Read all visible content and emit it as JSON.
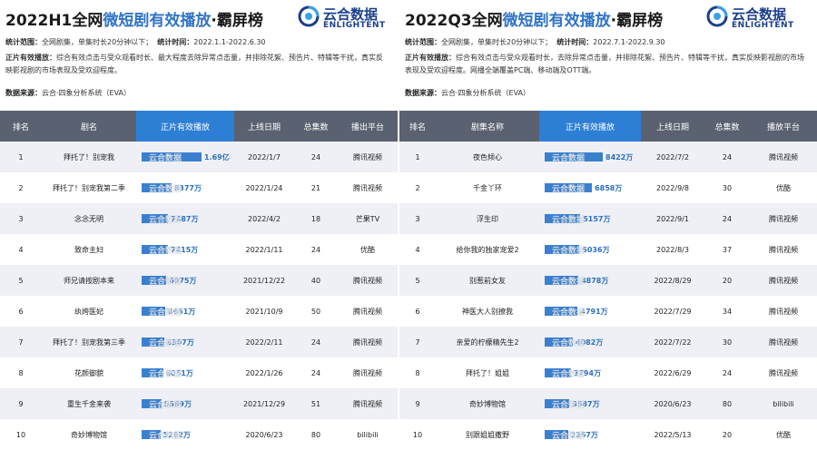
{
  "left": {
    "title_pre": "2022H1全网",
    "title_hl": "微短剧有效播放",
    "title_post": "·霸屏榜",
    "brand_name": "云合数据",
    "brand_sub": "ENLIGHTENT",
    "stat_range_label": "统计范围：",
    "stat_range": "全网剧集，单集时长20分钟以下；",
    "stat_time_label": "统计时间：",
    "stat_time": "2022.1.1-2022.6.30",
    "def_label": "正片有效播放：",
    "def_text": "综合有效点击与受众观看时长、最大程度去除异常点击量，并排除花絮、预告片、特辑等干扰，真实反映影视剧的市场表现及受欢迎程度。",
    "source_label": "数据来源：",
    "source": "云合·四象分析系统（EVA）",
    "headers": [
      "排名",
      "剧名",
      "正片有效播放",
      "上线日期",
      "总集数",
      "播出平台"
    ],
    "watermark": "云合数据",
    "rows": [
      {
        "rank": "1",
        "name": "拜托了！别宠我",
        "label": "1.69亿",
        "date": "2022/1/7",
        "eps": "24",
        "platform": "腾讯视频"
      },
      {
        "rank": "2",
        "name": "拜托了！别宠我第二季",
        "label": "8377万",
        "date": "2022/1/24",
        "eps": "21",
        "platform": "腾讯视频"
      },
      {
        "rank": "3",
        "name": "念念无明",
        "label": "7487万",
        "date": "2022/4/2",
        "eps": "18",
        "platform": "芒果TV"
      },
      {
        "rank": "4",
        "name": "致命主妇",
        "label": "7415万",
        "date": "2022/1/11",
        "eps": "24",
        "platform": "优酷"
      },
      {
        "rank": "5",
        "name": "师兄请按剧本来",
        "label": "6975万",
        "date": "2021/12/22",
        "eps": "40",
        "platform": "腾讯视频"
      },
      {
        "rank": "6",
        "name": "纨绔医妃",
        "label": "6661万",
        "date": "2021/10/9",
        "eps": "50",
        "platform": "腾讯视频"
      },
      {
        "rank": "7",
        "name": "拜托了！别宠我第三季",
        "label": "6307万",
        "date": "2022/2/11",
        "eps": "24",
        "platform": "腾讯视频"
      },
      {
        "rank": "8",
        "name": "花颜御貌",
        "label": "6051万",
        "date": "2022/1/26",
        "eps": "24",
        "platform": "腾讯视频"
      },
      {
        "rank": "9",
        "name": "重生千金来袭",
        "label": "5569万",
        "date": "2021/12/29",
        "eps": "51",
        "platform": "腾讯视频"
      },
      {
        "rank": "10",
        "name": "奇妙博物馆",
        "label": "5282万",
        "date": "2020/6/23",
        "eps": "80",
        "platform": "bilibili"
      }
    ]
  },
  "right": {
    "title_pre": "2022Q3全网",
    "title_hl": "微短剧有效播放",
    "title_post": "·霸屏榜",
    "brand_name": "云合数据",
    "brand_sub": "ENLIGHTENT",
    "stat_range_label": "统计范围：",
    "stat_range": "全网剧集，单集时长20分钟以下；",
    "stat_time_label": "统计时间：",
    "stat_time": "2022.7.1-2022.9.30",
    "def_label": "正片有效播放：",
    "def_text": "综合有效点击与受众观看时长，去除异常点击量，并排除花絮、预告片、特辑等干扰，真实反映影视剧的市场表现及受欢迎程度。网播全端覆盖PC端、移动端及OTT端。",
    "source_label": "数据来源：",
    "source": "云合·四象分析系统（EVA）",
    "headers": [
      "排名",
      "剧集名称",
      "正片有效播放",
      "上线日期",
      "总集数",
      "播放平台"
    ],
    "watermark": "云合数据",
    "rows": [
      {
        "rank": "1",
        "name": "夜色倾心",
        "label": "8422万",
        "date": "2022/7/2",
        "eps": "24",
        "platform": "腾讯视频"
      },
      {
        "rank": "2",
        "name": "千金丫环",
        "label": "6858万",
        "date": "2022/9/8",
        "eps": "30",
        "platform": "优酷"
      },
      {
        "rank": "3",
        "name": "浮生印",
        "label": "5157万",
        "date": "2022/9/1",
        "eps": "24",
        "platform": "腾讯视频"
      },
      {
        "rank": "4",
        "name": "给你我的独家宠爱2",
        "label": "5036万",
        "date": "2022/8/3",
        "eps": "37",
        "platform": "腾讯视频"
      },
      {
        "rank": "5",
        "name": "别惹前女友",
        "label": "4878万",
        "date": "2022/8/29",
        "eps": "20",
        "platform": "腾讯视频"
      },
      {
        "rank": "6",
        "name": "神医大人别撩我",
        "label": "4791万",
        "date": "2022/7/29",
        "eps": "34",
        "platform": "腾讯视频"
      },
      {
        "rank": "7",
        "name": "亲爱的柠檬精先生2",
        "label": "4082万",
        "date": "2022/7/22",
        "eps": "30",
        "platform": "腾讯视频"
      },
      {
        "rank": "8",
        "name": "拜托了！姐姐",
        "label": "3794万",
        "date": "2022/6/29",
        "eps": "24",
        "platform": "腾讯视频"
      },
      {
        "rank": "9",
        "name": "奇妙博物馆",
        "label": "3587万",
        "date": "2020/6/23",
        "eps": "80",
        "platform": "bilibili"
      },
      {
        "rank": "10",
        "name": "别跟姐姐撒野",
        "label": "3367万",
        "date": "2022/5/13",
        "eps": "20",
        "platform": "优酷"
      }
    ]
  },
  "colors": {
    "accent": "#2d7fd6",
    "header": "#5a6170",
    "bar": "#3a80cf",
    "brand": "#1b3f8a"
  },
  "chart_data": [
    {
      "type": "bar",
      "title": "2022H1全网微短剧有效播放·霸屏榜",
      "categories": [
        "拜托了！别宠我",
        "拜托了！别宠我第二季",
        "念念无明",
        "致命主妇",
        "师兄请按剧本来",
        "纨绔医妃",
        "拜托了！别宠我第三季",
        "花颜御貌",
        "重生千金来袭",
        "奇妙博物馆"
      ],
      "values": [
        16900,
        8377,
        7487,
        7415,
        6975,
        6661,
        6307,
        6051,
        5569,
        5282
      ],
      "unit": "万",
      "ylabel": "正片有效播放"
    },
    {
      "type": "bar",
      "title": "2022Q3全网微短剧有效播放·霸屏榜",
      "categories": [
        "夜色倾心",
        "千金丫环",
        "浮生印",
        "给你我的独家宠爱2",
        "别惹前女友",
        "神医大人别撩我",
        "亲爱的柠檬精先生2",
        "拜托了！姐姐",
        "奇妙博物馆",
        "别跟姐姐撒野"
      ],
      "values": [
        8422,
        6858,
        5157,
        5036,
        4878,
        4791,
        4082,
        3794,
        3587,
        3367
      ],
      "unit": "万",
      "ylabel": "正片有效播放"
    }
  ]
}
